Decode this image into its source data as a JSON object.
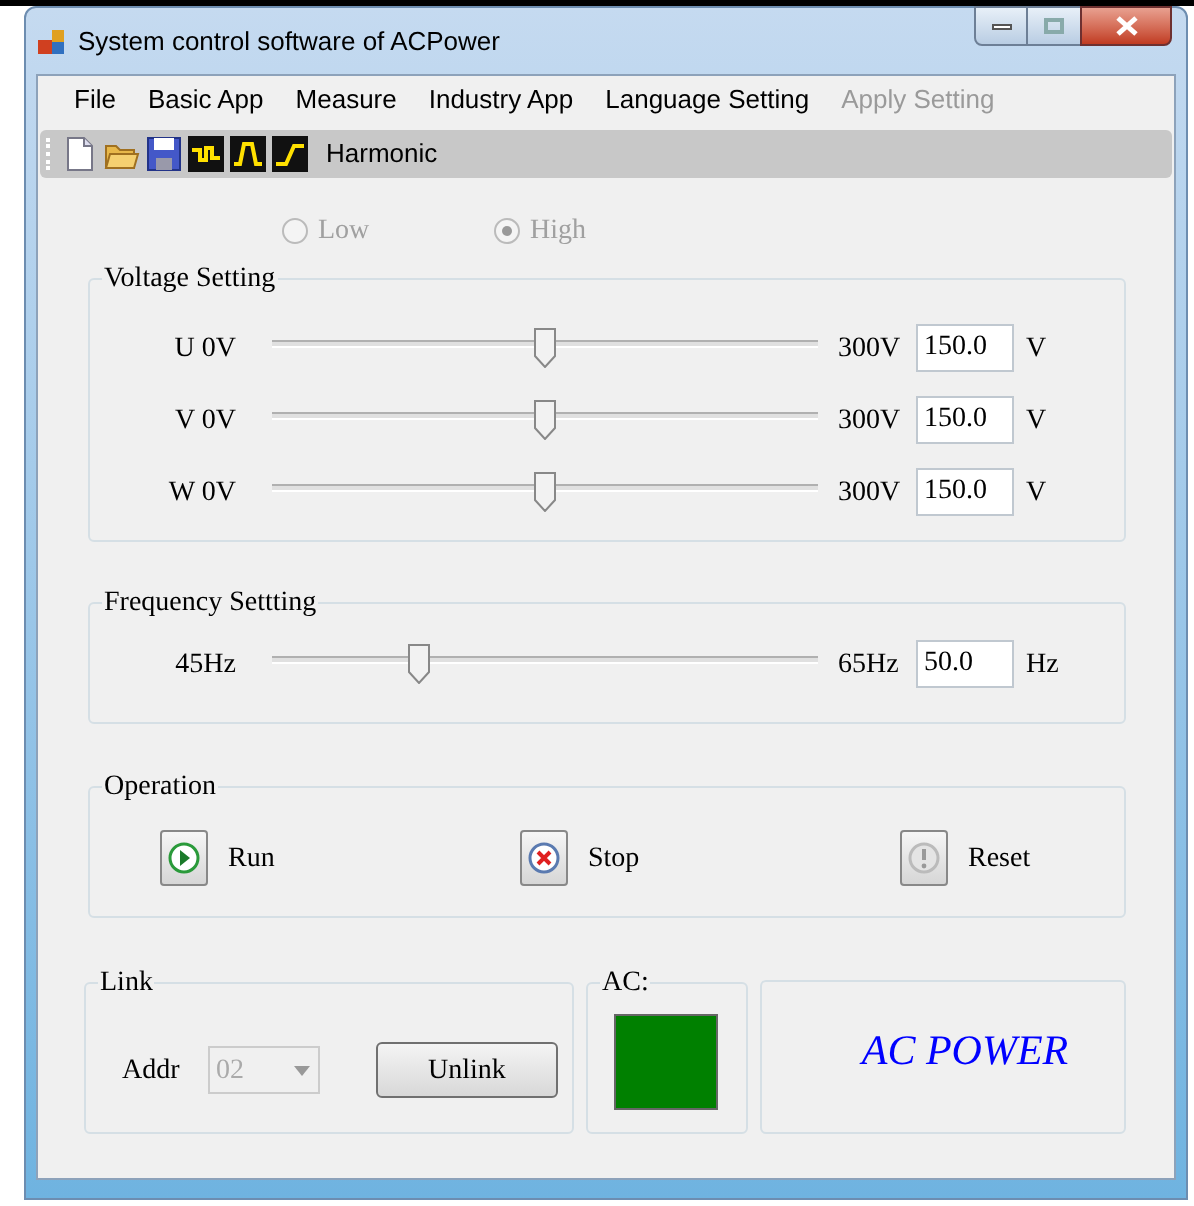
{
  "window": {
    "title": "System control software of ACPower"
  },
  "menu": [
    {
      "label": "File",
      "disabled": false
    },
    {
      "label": "Basic App",
      "disabled": false
    },
    {
      "label": "Measure",
      "disabled": false
    },
    {
      "label": "Industry App",
      "disabled": false
    },
    {
      "label": "Language Setting",
      "disabled": false
    },
    {
      "label": "Apply Setting",
      "disabled": true
    }
  ],
  "toolbar": [
    {
      "kind": "new"
    },
    {
      "kind": "open"
    },
    {
      "kind": "save"
    },
    {
      "kind": "wave_step"
    },
    {
      "kind": "wave_pulse"
    },
    {
      "kind": "wave_ramp"
    },
    {
      "kind": "text",
      "label": "Harmonic"
    }
  ],
  "range": {
    "disabled": true,
    "options": [
      {
        "label": "Low",
        "selected": false
      },
      {
        "label": "High",
        "selected": true
      }
    ]
  },
  "voltage_setting": {
    "title": "Voltage Setting",
    "channels": [
      {
        "label": "U 0V",
        "max": "300V",
        "level": 0.5,
        "value": "150.0",
        "unit": "V"
      },
      {
        "label": "V 0V",
        "max": "300V",
        "level": 0.5,
        "value": "150.0",
        "unit": "V"
      },
      {
        "label": "W 0V",
        "max": "300V",
        "level": 0.5,
        "value": "150.0",
        "unit": "V"
      }
    ]
  },
  "frequency_setting": {
    "title": "Frequency Settting",
    "min": "45Hz",
    "max": "65Hz",
    "level": 0.26,
    "value": "50.0",
    "unit": "Hz"
  },
  "operation": {
    "title": "Operation",
    "buttons": [
      {
        "kind": "run",
        "label": "Run"
      },
      {
        "kind": "stop",
        "label": "Stop"
      },
      {
        "kind": "reset",
        "label": "Reset"
      }
    ]
  },
  "link": {
    "title": "Link",
    "addr_label": "Addr",
    "addr": {
      "value": "02",
      "disabled": true
    },
    "button": "Unlink"
  },
  "ac": {
    "title": "AC:",
    "color": "#008000"
  },
  "logo": "AC POWER"
}
